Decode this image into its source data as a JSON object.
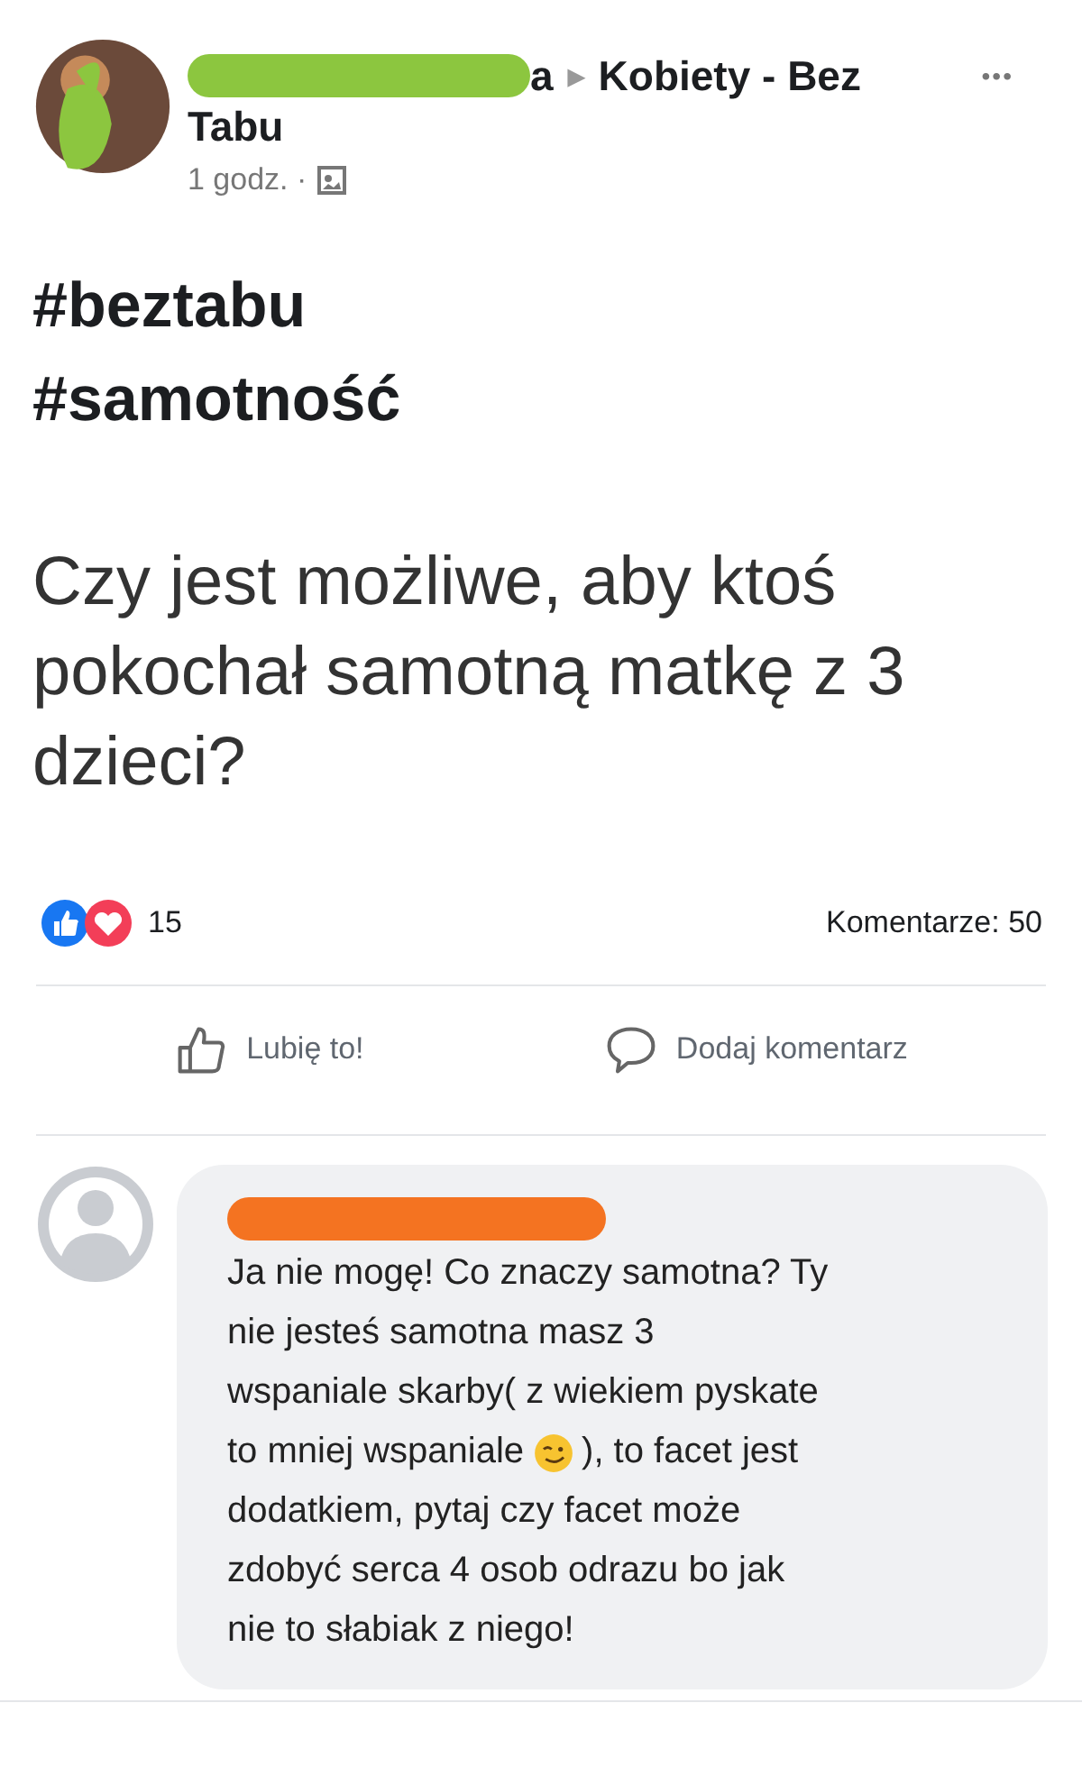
{
  "post": {
    "author_tail": "a",
    "arrow": "▸",
    "group_line1": "Kobiety - Bez",
    "group_line2": "Tabu",
    "more": "•••",
    "time": "1 godz. ·",
    "hashtags": [
      "#beztabu",
      "#samotność"
    ],
    "text": "Czy jest możliwe, aby ktoś pokochał samotną matkę z 3 dzieci?",
    "reactions_count": "15",
    "comments_count": "Komentarze: 50"
  },
  "actions": [
    {
      "kind": "like",
      "label": "Lubię to!"
    },
    {
      "kind": "comment",
      "label": "Dodaj komentarz"
    }
  ],
  "comment": {
    "lines": [
      {
        "kind": "text",
        "text": "Ja nie mogę! Co znaczy samotna? Ty"
      },
      {
        "kind": "text",
        "text": "nie jesteś samotna masz 3"
      },
      {
        "kind": "text",
        "text": "wspaniale skarby( z wiekiem pyskate"
      },
      {
        "kind": "emoji",
        "before": "to mniej wspaniale",
        "after": "), to facet jest"
      },
      {
        "kind": "text",
        "text": "dodatkiem, pytaj czy facet może"
      },
      {
        "kind": "text",
        "text": "zdobyć serca 4 osob odrazu bo jak"
      },
      {
        "kind": "text",
        "text": "nie to słabiak z niego!"
      }
    ]
  }
}
